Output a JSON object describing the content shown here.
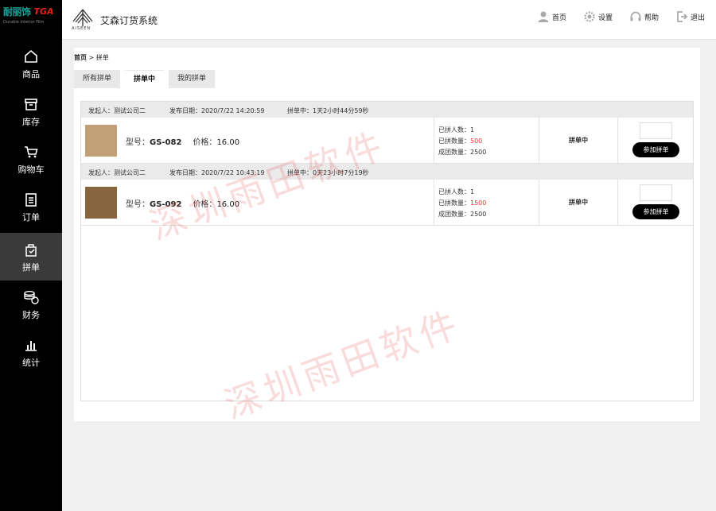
{
  "brand": {
    "name_cn": "耐丽饰",
    "name_tga": "TGA",
    "tagline": "Durable Interior Film"
  },
  "app": {
    "logo_text": "AISEEN",
    "title": "艾森订货系统"
  },
  "header_links": [
    {
      "label": "首页",
      "icon": "user-icon"
    },
    {
      "label": "设置",
      "icon": "gear-icon"
    },
    {
      "label": "帮助",
      "icon": "headset-icon"
    },
    {
      "label": "退出",
      "icon": "logout-icon"
    }
  ],
  "sidebar": {
    "items": [
      {
        "label": "商品",
        "icon": "home-icon",
        "active": false
      },
      {
        "label": "库存",
        "icon": "inventory-icon",
        "active": false
      },
      {
        "label": "购物车",
        "icon": "cart-icon",
        "active": false
      },
      {
        "label": "订单",
        "icon": "order-icon",
        "active": false
      },
      {
        "label": "拼单",
        "icon": "group-buy-icon",
        "active": true
      },
      {
        "label": "财务",
        "icon": "coins-icon",
        "active": false
      },
      {
        "label": "统计",
        "icon": "bar-chart-icon",
        "active": false
      }
    ]
  },
  "breadcrumb": {
    "home": "首页",
    "sep": ">",
    "current": "拼单"
  },
  "tabs": [
    {
      "label": "所有拼单",
      "active": false
    },
    {
      "label": "拼单中",
      "active": true
    },
    {
      "label": "我的拼单",
      "active": false
    }
  ],
  "groups": [
    {
      "initiator": "发起人：测试公司二",
      "publish_date": "发布日期：2020/7/22 14:20:59",
      "countdown": "拼单中：1天2小时44分59秒",
      "model_label": "型号：",
      "model": "GS-082",
      "price_label": "价格：",
      "price": "16.00",
      "joined_label": "已拼人数：",
      "joined": "1",
      "qty_label": "已拼数量：",
      "qty": "500",
      "target_label": "成团数量：",
      "target": "2500",
      "status": "拼单中",
      "swatch_color": "#c2a077",
      "join_label": "参加拼单"
    },
    {
      "initiator": "发起人：测试公司二",
      "publish_date": "发布日期：2020/7/22 10:43:19",
      "countdown": "拼单中：0天23小时7分19秒",
      "model_label": "型号：",
      "model": "GS-092",
      "price_label": "价格：",
      "price": "16.00",
      "joined_label": "已拼人数：",
      "joined": "1",
      "qty_label": "已拼数量：",
      "qty": "1500",
      "target_label": "成团数量：",
      "target": "2500",
      "status": "拼单中",
      "swatch_color": "#86653f",
      "join_label": "参加拼单"
    }
  ],
  "watermark": "深圳雨田软件",
  "colors": {
    "sidebar_bg": "#000000",
    "sidebar_active": "#3a3a3a",
    "accent_red": "#e33333",
    "button_bg": "#000000"
  }
}
